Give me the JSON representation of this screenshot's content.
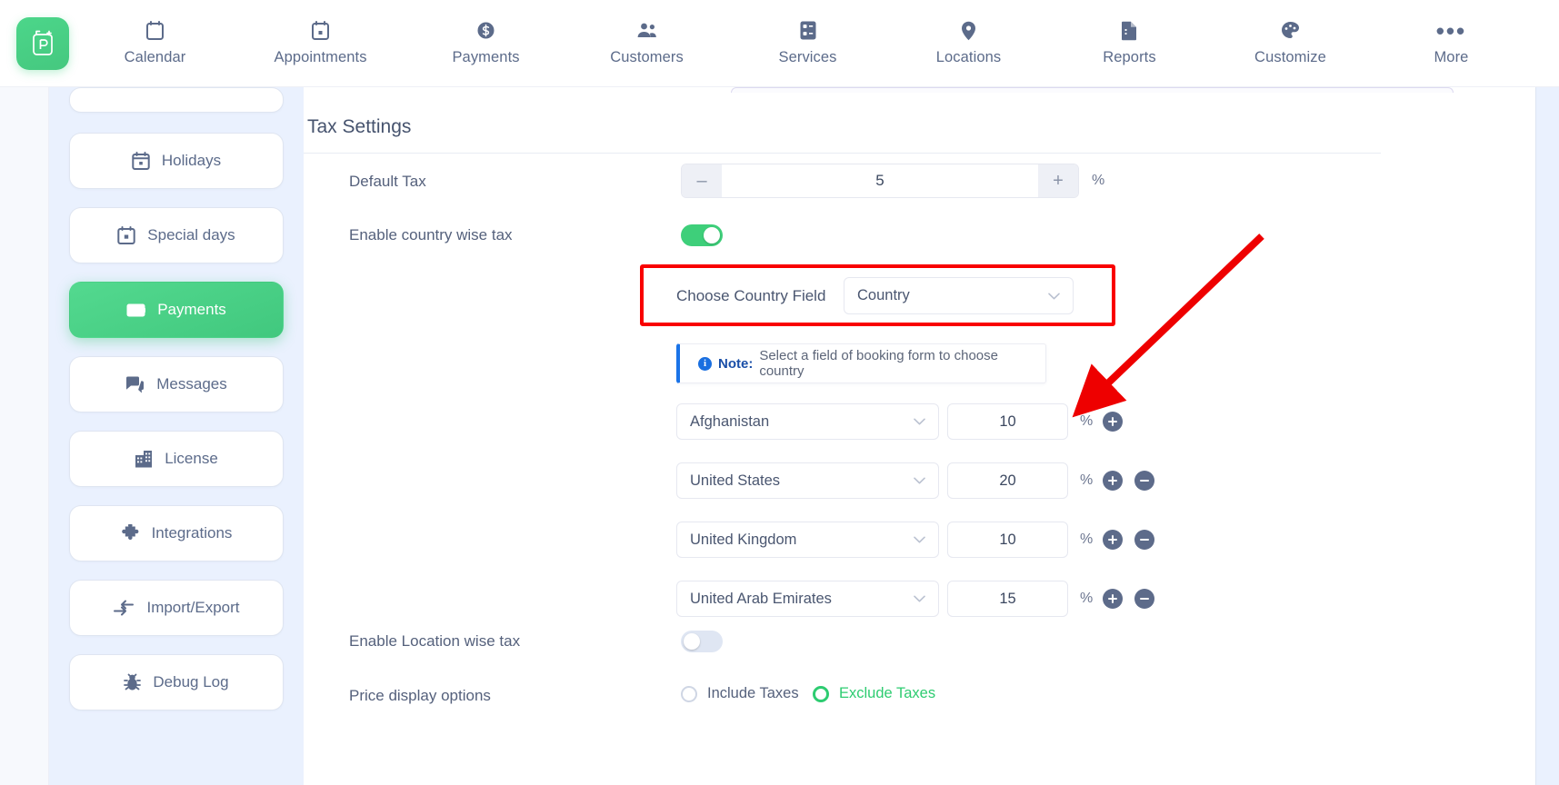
{
  "brand": {
    "icon": "booking-logo-icon",
    "color": "#45c87f"
  },
  "topnav": {
    "items": [
      {
        "label": "Calendar",
        "icon": "calendar-icon"
      },
      {
        "label": "Appointments",
        "icon": "appointments-calendar-icon"
      },
      {
        "label": "Payments",
        "icon": "dollar-coin-icon"
      },
      {
        "label": "Customers",
        "icon": "people-icon"
      },
      {
        "label": "Services",
        "icon": "services-grid-icon"
      },
      {
        "label": "Locations",
        "icon": "map-pin-icon"
      },
      {
        "label": "Reports",
        "icon": "report-document-icon"
      },
      {
        "label": "Customize",
        "icon": "palette-icon"
      },
      {
        "label": "More",
        "icon": "ellipsis-icon"
      }
    ]
  },
  "sidebar": {
    "items": [
      {
        "label": "",
        "icon": "",
        "active": false,
        "partial": true
      },
      {
        "label": "Holidays",
        "icon": "calendar-icon",
        "active": false,
        "partial": false
      },
      {
        "label": "Special days",
        "icon": "calendar-day-icon",
        "active": false,
        "partial": false
      },
      {
        "label": "Payments",
        "icon": "wallet-icon",
        "active": true,
        "partial": false
      },
      {
        "label": "Messages",
        "icon": "chat-icon",
        "active": false,
        "partial": false
      },
      {
        "label": "License",
        "icon": "building-icon",
        "active": false,
        "partial": false
      },
      {
        "label": "Integrations",
        "icon": "puzzle-icon",
        "active": false,
        "partial": false
      },
      {
        "label": "Import/Export",
        "icon": "import-export-icon",
        "active": false,
        "partial": false
      },
      {
        "label": "Debug Log",
        "icon": "bug-icon",
        "active": false,
        "partial": false
      }
    ]
  },
  "main": {
    "section_title": "Tax Settings",
    "default_tax": {
      "label": "Default Tax",
      "value": "5",
      "minus": "–",
      "plus": "+",
      "unit": "%"
    },
    "enable_country_wise_tax": {
      "label": "Enable country wise tax",
      "state": "on"
    },
    "choose_country_field": {
      "label": "Choose Country Field",
      "value": "Country"
    },
    "note": {
      "prefix": "Note:",
      "text": "Select a field of booking form to choose country"
    },
    "country_taxes": [
      {
        "country": "Afghanistan",
        "value": "10",
        "unit": "%",
        "has_add": true,
        "has_remove": false
      },
      {
        "country": "United States",
        "value": "20",
        "unit": "%",
        "has_add": true,
        "has_remove": true
      },
      {
        "country": "United Kingdom",
        "value": "10",
        "unit": "%",
        "has_add": true,
        "has_remove": true
      },
      {
        "country": "United Arab Emirates",
        "value": "15",
        "unit": "%",
        "has_add": true,
        "has_remove": true
      }
    ],
    "enable_location_wise_tax": {
      "label": "Enable Location wise tax",
      "state": "off"
    },
    "price_display_options": {
      "label": "Price display options",
      "options": [
        {
          "label": "Include Taxes",
          "selected": false
        },
        {
          "label": "Exclude Taxes",
          "selected": true
        }
      ]
    }
  },
  "annotations": {
    "highlight_box_color": "#f90000",
    "arrow_color": "#ee0000",
    "arrow_target": "add-country-tax-row-button"
  }
}
